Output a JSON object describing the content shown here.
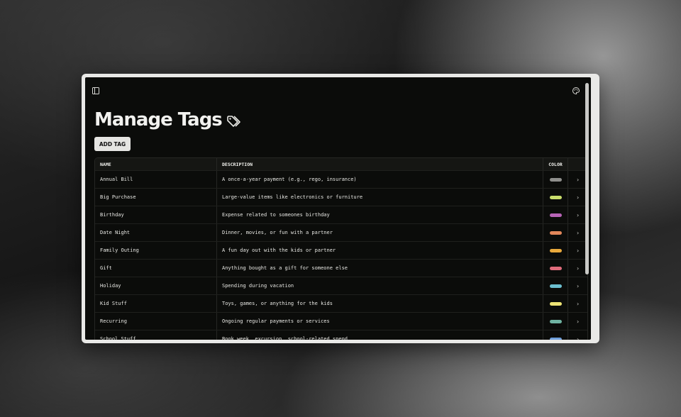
{
  "header": {
    "sidebar_toggle_icon": "sidebar-panel-icon",
    "palette_icon": "palette-icon"
  },
  "page": {
    "title": "Manage Tags",
    "title_icon": "tags-icon",
    "add_button_label": "ADD TAG"
  },
  "table": {
    "columns": {
      "name": "NAME",
      "description": "DESCRIPTION",
      "color": "COLOR"
    },
    "rows": [
      {
        "name": "Annual Bill",
        "description": "A once-a-year payment (e.g., rego, insurance)",
        "color": "#8f8f8c"
      },
      {
        "name": "Big Purchase",
        "description": "Large-value items like electronics or furniture",
        "color": "#c9dd6c"
      },
      {
        "name": "Birthday",
        "description": "Expense related to someones birthday",
        "color": "#b764b6"
      },
      {
        "name": "Date Night",
        "description": "Dinner, movies, or fun with a partner",
        "color": "#e2875a"
      },
      {
        "name": "Family Outing",
        "description": "A fun day out with the kids or partner",
        "color": "#e9a93c"
      },
      {
        "name": "Gift",
        "description": "Anything bought as a gift for someone else",
        "color": "#e06c7c"
      },
      {
        "name": "Holiday",
        "description": "Spending during vacation",
        "color": "#6cbfcf"
      },
      {
        "name": "Kid Stuff",
        "description": "Toys, games, or anything for the kids",
        "color": "#ece274"
      },
      {
        "name": "Recurring",
        "description": "Ongoing regular payments or services",
        "color": "#6fb3a2"
      },
      {
        "name": "School Stuff",
        "description": "Book week, excursion, school-related spend",
        "color": "#6f9fdc"
      }
    ],
    "row_action_icon": "chevron-right-icon"
  }
}
